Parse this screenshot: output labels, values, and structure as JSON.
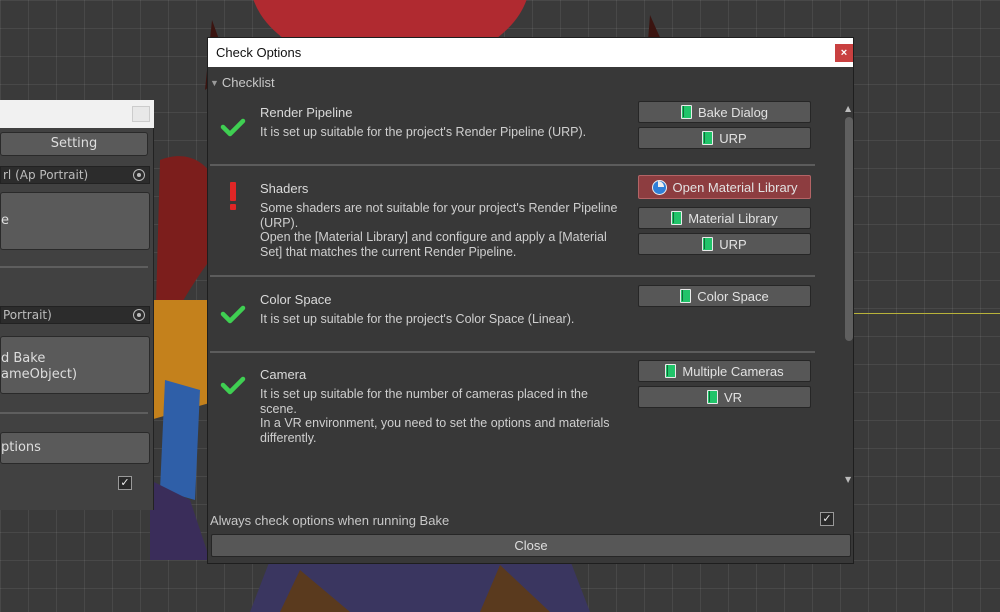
{
  "left_panel": {
    "setting_button": "Setting",
    "field1_value": "rl (Ap Portrait)",
    "big_button1": "e",
    "field2_value": "Portrait)",
    "big_button2_line1": "d Bake",
    "big_button2_line2": "ameObject)",
    "options_button": "ptions",
    "check_mark": "✓"
  },
  "dialog": {
    "title": "Check Options",
    "close_glyph": "×",
    "foldout_arrow": "▼",
    "foldout_label": "Checklist",
    "sections": [
      {
        "title": "Render Pipeline",
        "icon": "ok-check-icon",
        "desc": [
          "It is set up suitable for the project's Render Pipeline (URP)."
        ],
        "buttons": [
          "Bake Dialog",
          "URP"
        ]
      },
      {
        "title": "Shaders",
        "icon": "warning-exclamation-icon",
        "desc": [
          "Some shaders are not suitable for your project's Render Pipeline (URP).",
          "Open the [Material Library] and configure and apply a [Material Set] that matches the current Render Pipeline."
        ],
        "buttons": [
          "Open Material Library",
          "Material Library",
          "URP"
        ]
      },
      {
        "title": "Color Space",
        "icon": "ok-check-icon",
        "desc": [
          "It is set up suitable for the project's Color Space (Linear)."
        ],
        "buttons": [
          "Color Space"
        ]
      },
      {
        "title": "Camera",
        "icon": "ok-check-icon",
        "desc": [
          "It is set up suitable for the number of cameras placed in the scene.",
          "In a VR environment, you need to set the options and materials differently."
        ],
        "buttons": [
          "Multiple Cameras",
          "VR"
        ]
      }
    ],
    "scroll_up": "▲",
    "scroll_down": "▼",
    "footer_label": "Always check options when running Bake",
    "footer_check": "✓",
    "close_label": "Close"
  },
  "colors": {
    "ok_green": "#3fcf52",
    "warn_red": "#e02626",
    "highlight_button": "#8d3d40",
    "gizmo_yellow": "#b8b23a"
  }
}
